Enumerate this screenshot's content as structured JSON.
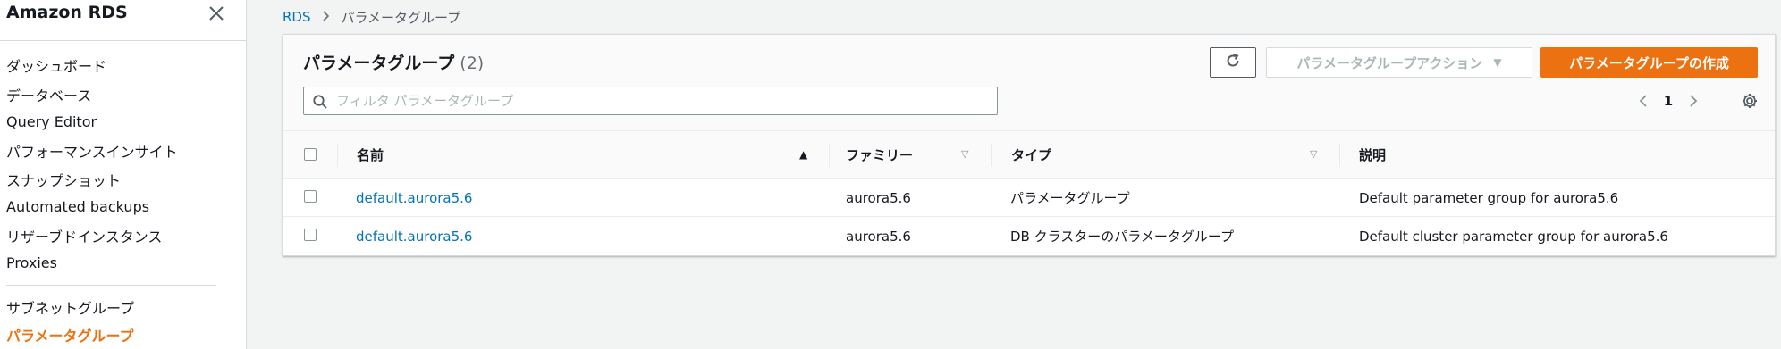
{
  "sidebar": {
    "title": "Amazon RDS",
    "items": [
      {
        "label": "ダッシュボード"
      },
      {
        "label": "データベース"
      },
      {
        "label": "Query Editor"
      },
      {
        "label": "パフォーマンスインサイト"
      },
      {
        "label": "スナップショット"
      },
      {
        "label": "Automated backups"
      },
      {
        "label": "リザーブドインスタンス"
      },
      {
        "label": "Proxies"
      },
      {
        "label": "サブネットグループ"
      },
      {
        "label": "パラメータグループ"
      }
    ],
    "active_item": "パラメータグループ"
  },
  "breadcrumb": {
    "root": "RDS",
    "current": "パラメータグループ"
  },
  "panel": {
    "title": "パラメータグループ",
    "count": "(2)",
    "actions_label": "パラメータグループアクション",
    "create_label": "パラメータグループの作成",
    "search_placeholder": "フィルタ パラメータグループ",
    "page": "1"
  },
  "table": {
    "columns": [
      "名前",
      "ファミリー",
      "タイプ",
      "説明"
    ],
    "rows": [
      {
        "name": "default.aurora5.6",
        "family": "aurora5.6",
        "type": "パラメータグループ",
        "description": "Default parameter group for aurora5.6"
      },
      {
        "name": "default.aurora5.6",
        "family": "aurora5.6",
        "type": "DB クラスターのパラメータグループ",
        "description": "Default cluster parameter group for aurora5.6"
      }
    ]
  },
  "colors": {
    "accent": "#ec7211",
    "link": "#0073bb"
  },
  "icons": {
    "close": "close-icon",
    "breadcrumb_separator": "chevron-right-icon",
    "refresh": "refresh-icon",
    "dropdown": "caret-down-icon",
    "search": "search-icon",
    "prev": "chevron-left-icon",
    "next": "chevron-right-icon",
    "settings": "gear-icon",
    "sort_asc": "sort-ascending-icon",
    "sort": "sort-icon"
  }
}
